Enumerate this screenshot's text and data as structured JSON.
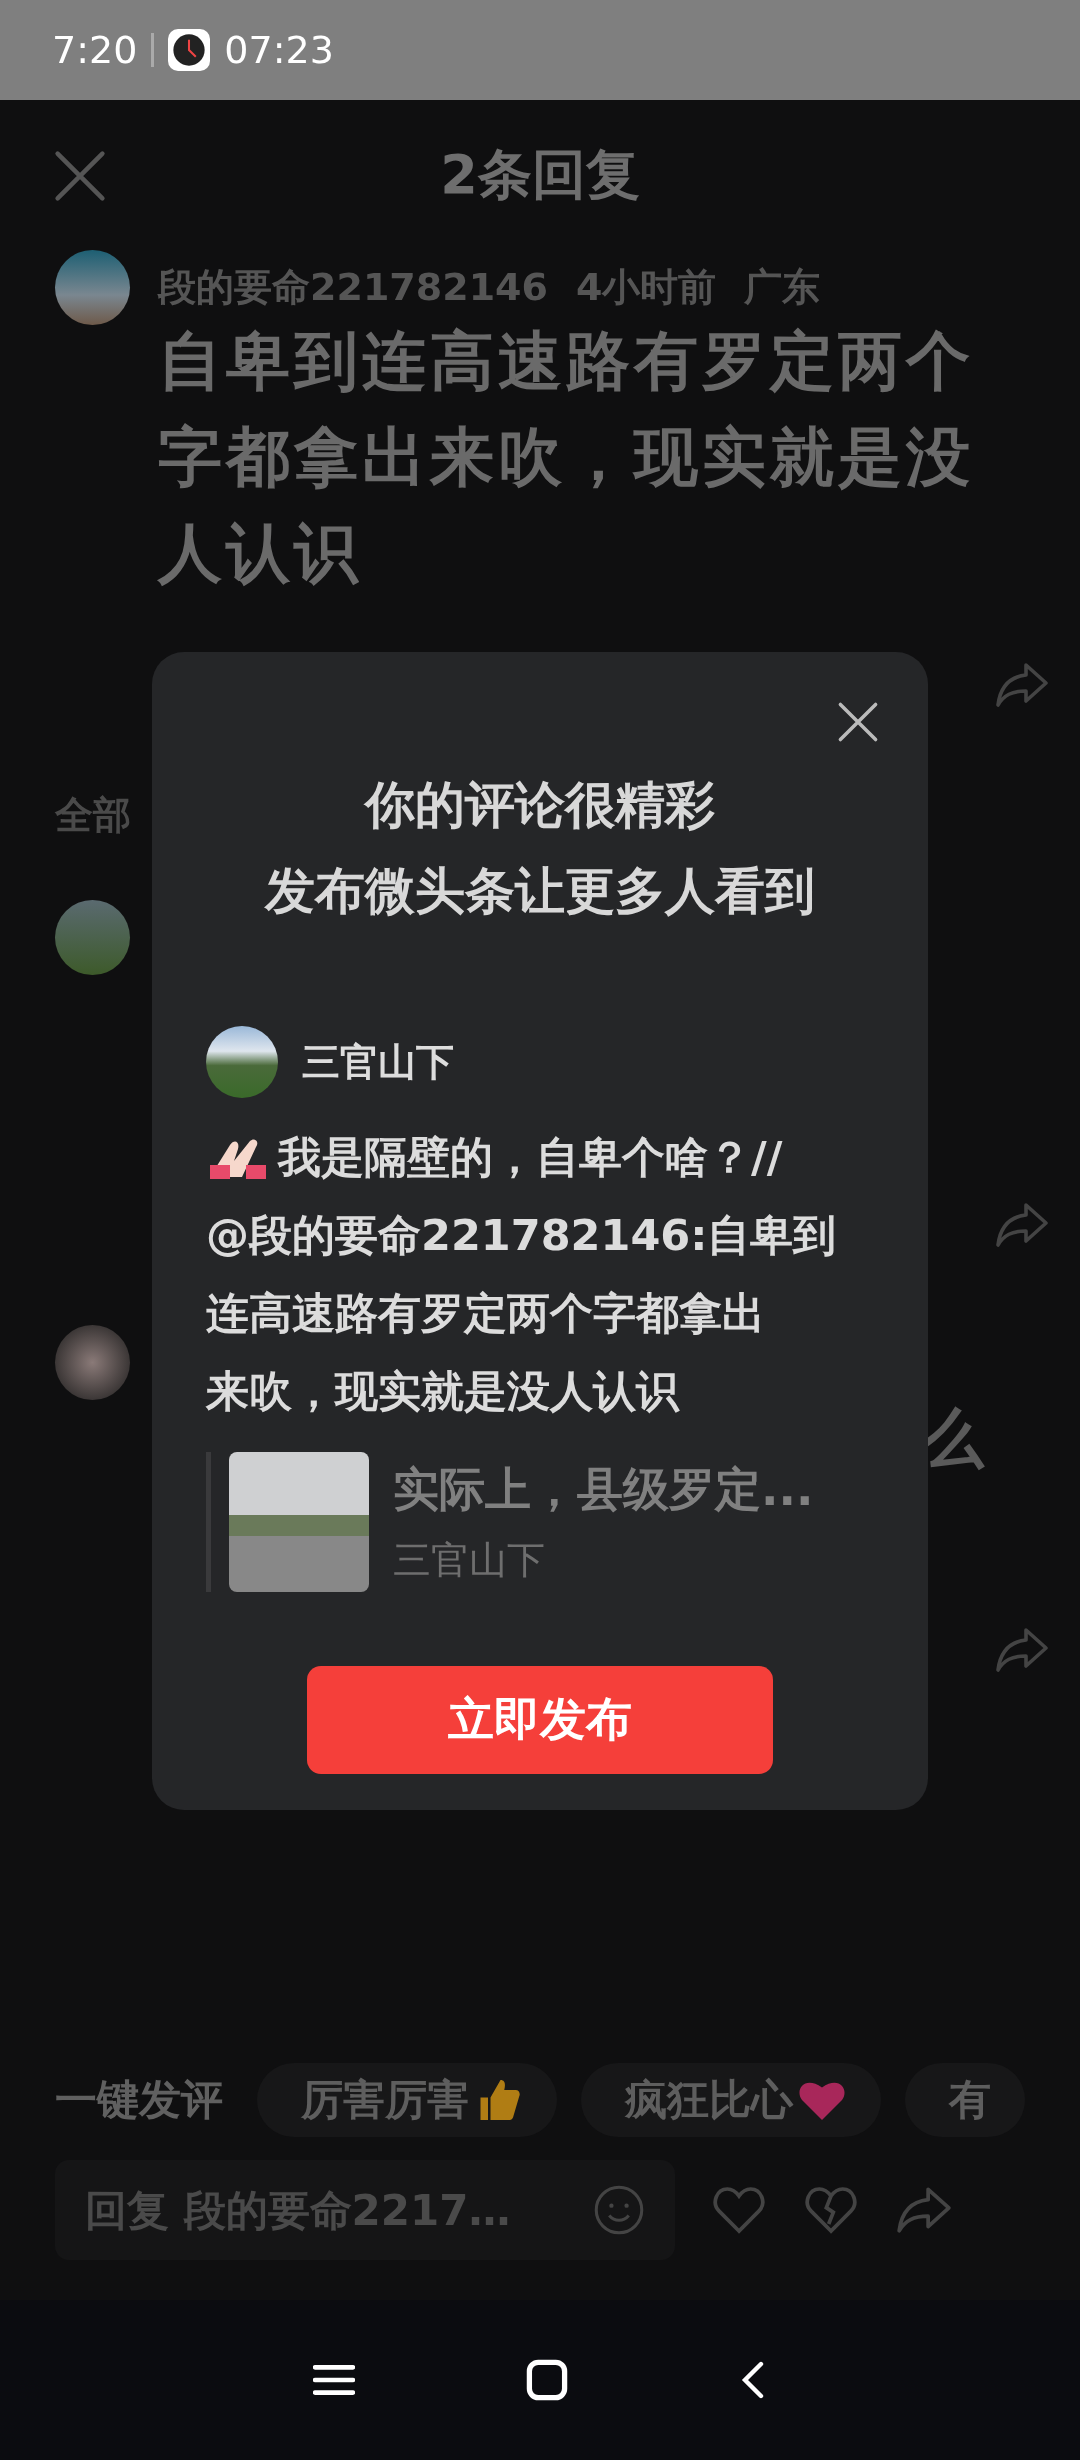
{
  "status_bar": {
    "time": "7:20",
    "clock_time": "07:23"
  },
  "header": {
    "title": "2条回复"
  },
  "comment": {
    "author": "段的要命221782146",
    "time": "4小时前",
    "location": "广东",
    "text": "自卑到连高速路有罗定两个字都拿出来吹，现实就是没人认识"
  },
  "section_label": "全部",
  "reply_fragment": "么",
  "dialog": {
    "title_lines": [
      "你的评论很精彩",
      "发布微头条让更多人看到"
    ],
    "user": "三官山下",
    "text_lines": [
      "我是隔壁的，自卑个啥？//",
      "@段的要命221782146:自卑到",
      "连高速路有罗定两个字都拿出",
      "来吹，现实就是没人认识"
    ],
    "quote": {
      "title": "实际上，县级罗定...",
      "author": "三官山下"
    },
    "button": "立即发布"
  },
  "quick_replies": {
    "label": "一键发评",
    "chips": [
      {
        "text": "厉害厉害",
        "kind": "thumb"
      },
      {
        "text": "疯狂比心",
        "kind": "heart"
      },
      {
        "text": "有",
        "kind": "plain"
      }
    ]
  },
  "reply_input": {
    "placeholder": "回复 段的要命2217…"
  }
}
